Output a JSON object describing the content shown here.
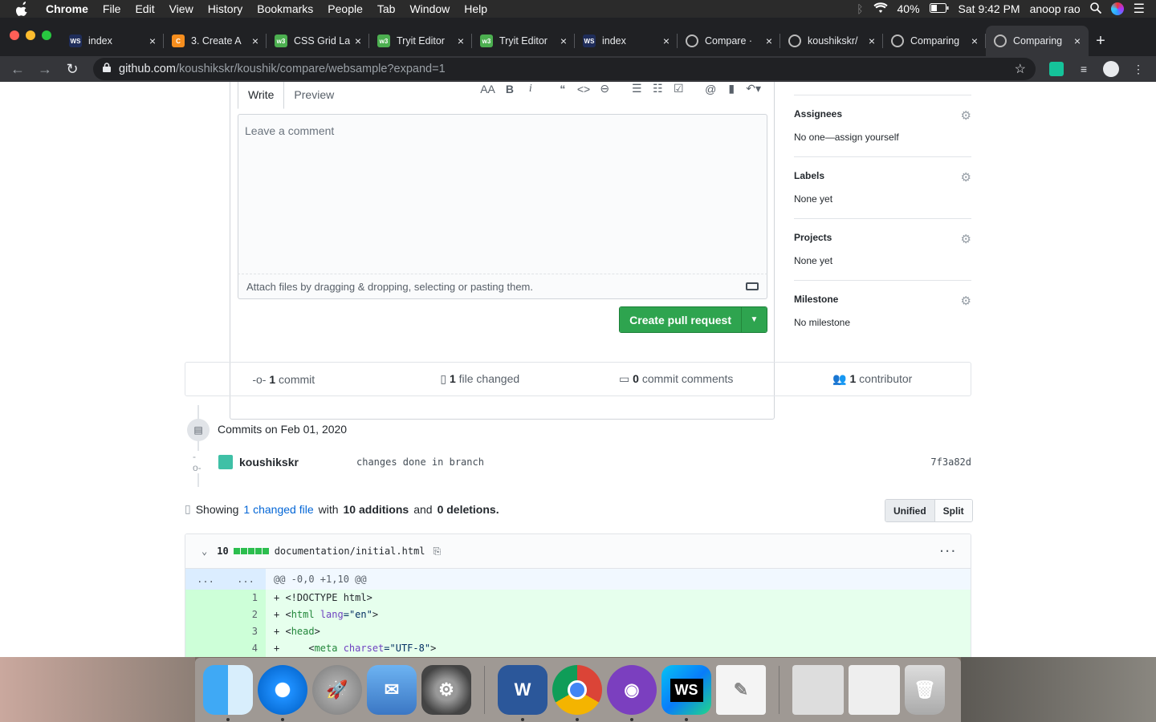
{
  "menubar": {
    "app": "Chrome",
    "items": [
      "File",
      "Edit",
      "View",
      "History",
      "Bookmarks",
      "People",
      "Tab",
      "Window",
      "Help"
    ],
    "battery": "40%",
    "clock": "Sat 9:42 PM",
    "user": "anoop rao"
  },
  "tabs": [
    {
      "title": "index",
      "icon": "webstorm-icon",
      "color": "#1f2d5a"
    },
    {
      "title": "3. Create A",
      "icon": "c-icon",
      "color": "#f68e1e"
    },
    {
      "title": "CSS Grid La",
      "icon": "w3-icon",
      "color": "#4caf50"
    },
    {
      "title": "Tryit Editor",
      "icon": "w3-icon",
      "color": "#4caf50"
    },
    {
      "title": "Tryit Editor",
      "icon": "w3-icon",
      "color": "#4caf50"
    },
    {
      "title": "index",
      "icon": "webstorm-icon",
      "color": "#1f2d5a"
    },
    {
      "title": "Compare ·",
      "icon": "github-icon",
      "color": "#24292e"
    },
    {
      "title": "koushikskr/",
      "icon": "github-icon",
      "color": "#24292e"
    },
    {
      "title": "Comparing",
      "icon": "github-icon",
      "color": "#24292e"
    },
    {
      "title": "Comparing",
      "icon": "github-icon",
      "color": "#24292e"
    }
  ],
  "url": {
    "host": "github.com",
    "path": "/koushikskr/koushik/compare/websample?expand=1"
  },
  "editor": {
    "write_tab": "Write",
    "preview_tab": "Preview",
    "placeholder": "Leave a comment",
    "attach_text": "Attach files by dragging & dropping, selecting or pasting them.",
    "create_button": "Create pull request"
  },
  "sidebar": [
    {
      "heading": "Assignees",
      "value": "No one—assign yourself"
    },
    {
      "heading": "Labels",
      "value": "None yet"
    },
    {
      "heading": "Projects",
      "value": "None yet"
    },
    {
      "heading": "Milestone",
      "value": "No milestone"
    }
  ],
  "summary": {
    "commits_n": "1",
    "commits": "commit",
    "files_n": "1",
    "files": "file changed",
    "comments_n": "0",
    "comments": "commit comments",
    "contrib_n": "1",
    "contrib": "contributor"
  },
  "commits": {
    "date": "Commits on Feb 01, 2020",
    "author": "koushikskr",
    "message": "changes done in branch",
    "sha": "7f3a82d"
  },
  "showing": {
    "pre": "Showing",
    "link": "1 changed file",
    "mid": "with",
    "adds": "10 additions",
    "and": "and",
    "dels": "0 deletions."
  },
  "view_toggle": {
    "unified": "Unified",
    "split": "Split"
  },
  "file": {
    "count": "10",
    "path": "documentation/initial.html",
    "hunk": "@@ -0,0 +1,10 @@",
    "hunk_dots": "...",
    "more": "···"
  },
  "diff_lines": [
    {
      "n": "1",
      "pre": "+ <!DOCTYPE html>",
      "tag": "",
      "attr": "",
      "val": "",
      "post": ""
    },
    {
      "n": "2",
      "pre": "+ <",
      "tag": "html",
      "attr": " lang",
      "val": "=\"en\"",
      "post": ">"
    },
    {
      "n": "3",
      "pre": "+ <",
      "tag": "head",
      "attr": "",
      "val": "",
      "post": ">"
    },
    {
      "n": "4",
      "pre": "+     <",
      "tag": "meta",
      "attr": " charset",
      "val": "=\"UTF-8\"",
      "post": ">"
    }
  ]
}
